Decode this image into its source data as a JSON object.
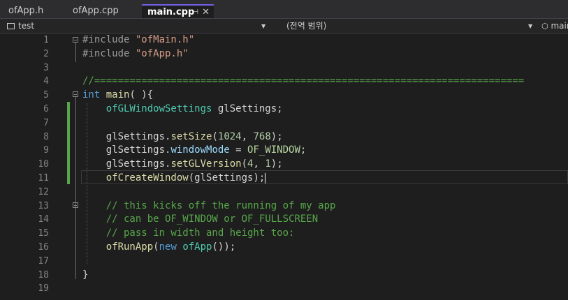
{
  "tabs": [
    {
      "label": "ofApp.h",
      "active": false
    },
    {
      "label": "ofApp.cpp",
      "active": false
    },
    {
      "label": "main.cpp",
      "active": true
    }
  ],
  "navbar": {
    "project": "test",
    "scope": "(전역 범위)",
    "member": "main"
  },
  "code_lines": [
    {
      "num": "1",
      "tokens": [
        [
          "#include ",
          "pp"
        ],
        [
          "\"ofMain.h\"",
          "str"
        ]
      ]
    },
    {
      "num": "2",
      "tokens": [
        [
          "#include ",
          "pp"
        ],
        [
          "\"ofApp.h\"",
          "str"
        ]
      ]
    },
    {
      "num": "3",
      "tokens": []
    },
    {
      "num": "4",
      "tokens": [
        [
          "//=========================================================================",
          "cm"
        ]
      ]
    },
    {
      "num": "5",
      "tokens": [
        [
          "int ",
          "kw"
        ],
        [
          "main",
          "fn"
        ],
        [
          "( ){",
          ""
        ]
      ]
    },
    {
      "num": "6",
      "tokens": [
        [
          "    ",
          ""
        ],
        [
          "ofGLWindowSettings",
          "ty"
        ],
        [
          " glSettings;",
          ""
        ]
      ]
    },
    {
      "num": "7",
      "tokens": []
    },
    {
      "num": "8",
      "tokens": [
        [
          "    glSettings.",
          ""
        ],
        [
          "setSize",
          "fn"
        ],
        [
          "(",
          ""
        ],
        [
          "1024",
          "num"
        ],
        [
          ", ",
          ""
        ],
        [
          "768",
          "num"
        ],
        [
          ");",
          ""
        ]
      ]
    },
    {
      "num": "9",
      "tokens": [
        [
          "    glSettings.",
          ""
        ],
        [
          "windowMode",
          "id"
        ],
        [
          " = ",
          ""
        ],
        [
          "OF_WINDOW",
          "en"
        ],
        [
          ";",
          ""
        ]
      ]
    },
    {
      "num": "10",
      "tokens": [
        [
          "    glSettings.",
          ""
        ],
        [
          "setGLVersion",
          "fn"
        ],
        [
          "(",
          ""
        ],
        [
          "4",
          "num"
        ],
        [
          ", ",
          ""
        ],
        [
          "1",
          "num"
        ],
        [
          ");",
          ""
        ]
      ]
    },
    {
      "num": "11",
      "tokens": [
        [
          "    ",
          ""
        ],
        [
          "ofCreateWindow",
          "fn"
        ],
        [
          "(glSettings);",
          ""
        ]
      ]
    },
    {
      "num": "12",
      "tokens": []
    },
    {
      "num": "13",
      "tokens": [
        [
          "    ",
          ""
        ],
        [
          "// this kicks off the running of my app",
          "cm"
        ]
      ]
    },
    {
      "num": "14",
      "tokens": [
        [
          "    ",
          ""
        ],
        [
          "// can be OF_WINDOW or OF_FULLSCREEN",
          "cm"
        ]
      ]
    },
    {
      "num": "15",
      "tokens": [
        [
          "    ",
          ""
        ],
        [
          "// pass in width and height too:",
          "cm"
        ]
      ]
    },
    {
      "num": "16",
      "tokens": [
        [
          "    ",
          ""
        ],
        [
          "ofRunApp",
          "fn"
        ],
        [
          "(",
          ""
        ],
        [
          "new ",
          "kw"
        ],
        [
          "ofApp",
          "ty"
        ],
        [
          "());",
          ""
        ]
      ]
    },
    {
      "num": "17",
      "tokens": []
    },
    {
      "num": "18",
      "tokens": [
        [
          "}",
          ""
        ]
      ]
    },
    {
      "num": "19",
      "tokens": []
    }
  ]
}
